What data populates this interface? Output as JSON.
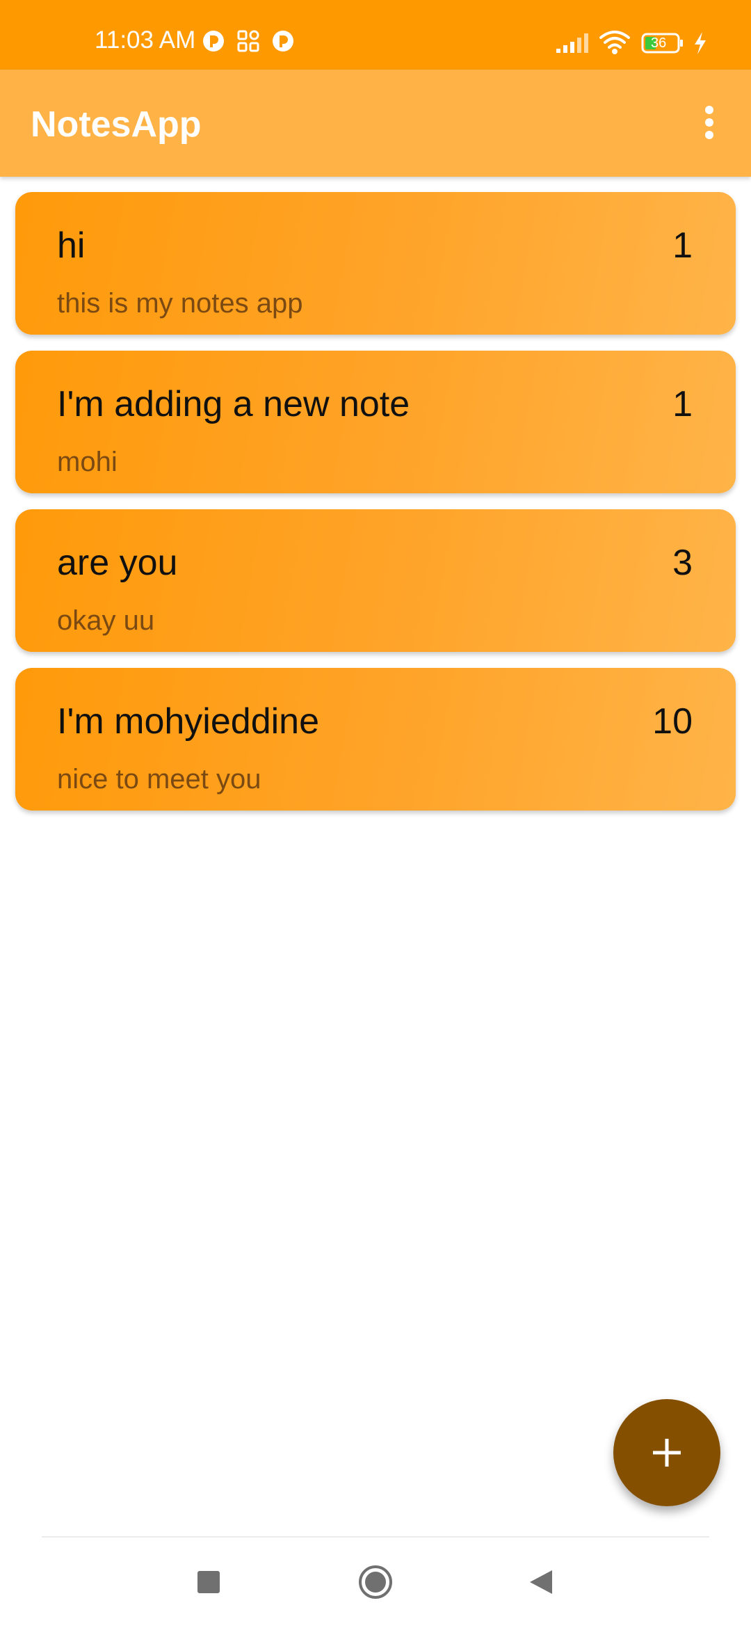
{
  "status_bar": {
    "time": "11:03 AM",
    "notification_icons": [
      "app-notification-icon",
      "grid-apps-icon",
      "app-notification-icon"
    ],
    "battery_level": "36",
    "icons": [
      "signal-icon",
      "wifi-icon",
      "battery-icon",
      "charging-icon"
    ]
  },
  "app_bar": {
    "title": "NotesApp",
    "menu_icon": "more-vertical-icon"
  },
  "notes": [
    {
      "title": "hi",
      "count": "1",
      "body": "this is my notes app"
    },
    {
      "title": "I'm adding a new note",
      "count": "1",
      "body": "mohi"
    },
    {
      "title": "are you",
      "count": "3",
      "body": "okay uu"
    },
    {
      "title": "I'm mohyieddine",
      "count": "10",
      "body": "nice to meet you"
    }
  ],
  "fab": {
    "icon": "plus-icon"
  },
  "nav_bar": {
    "buttons": [
      "recents-square-icon",
      "home-circle-icon",
      "back-triangle-icon"
    ]
  },
  "colors": {
    "status_bar": "#fe9900",
    "app_bar": "#ffb347",
    "card_start": "#ff9a0a",
    "card_end": "#ffb448",
    "fab": "#854f00"
  }
}
